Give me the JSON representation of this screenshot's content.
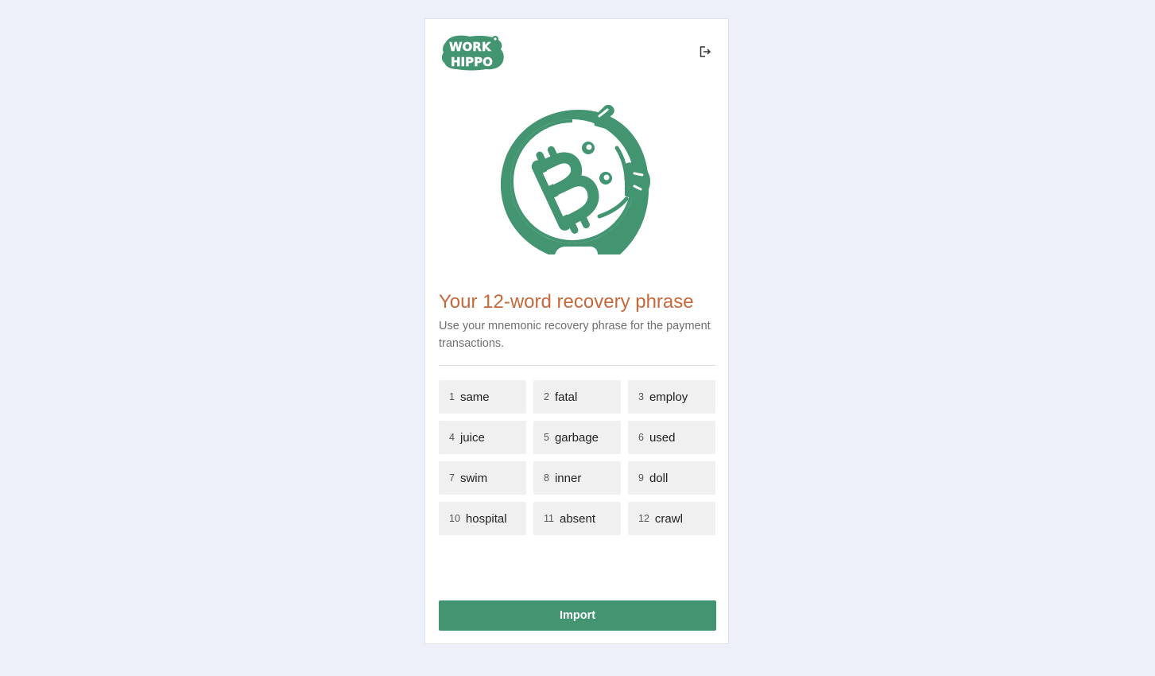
{
  "brand": {
    "logo_text_top": "WORK",
    "logo_text_bottom": "HIPPO",
    "color": "#439571"
  },
  "header": {
    "logout_icon": "logout-icon"
  },
  "hero": {
    "icon": "hippo-bitcoin-icon"
  },
  "main": {
    "title": "Your 12-word recovery phrase",
    "subtitle": "Use your mnemonic recovery phrase for the payment transactions.",
    "title_color": "#c6683a"
  },
  "words": [
    {
      "index": "1",
      "word": "same"
    },
    {
      "index": "2",
      "word": "fatal"
    },
    {
      "index": "3",
      "word": "employ"
    },
    {
      "index": "4",
      "word": "juice"
    },
    {
      "index": "5",
      "word": "garbage"
    },
    {
      "index": "6",
      "word": "used"
    },
    {
      "index": "7",
      "word": "swim"
    },
    {
      "index": "8",
      "word": "inner"
    },
    {
      "index": "9",
      "word": "doll"
    },
    {
      "index": "10",
      "word": "hospital"
    },
    {
      "index": "11",
      "word": "absent"
    },
    {
      "index": "12",
      "word": "crawl"
    }
  ],
  "actions": {
    "import_label": "Import"
  }
}
